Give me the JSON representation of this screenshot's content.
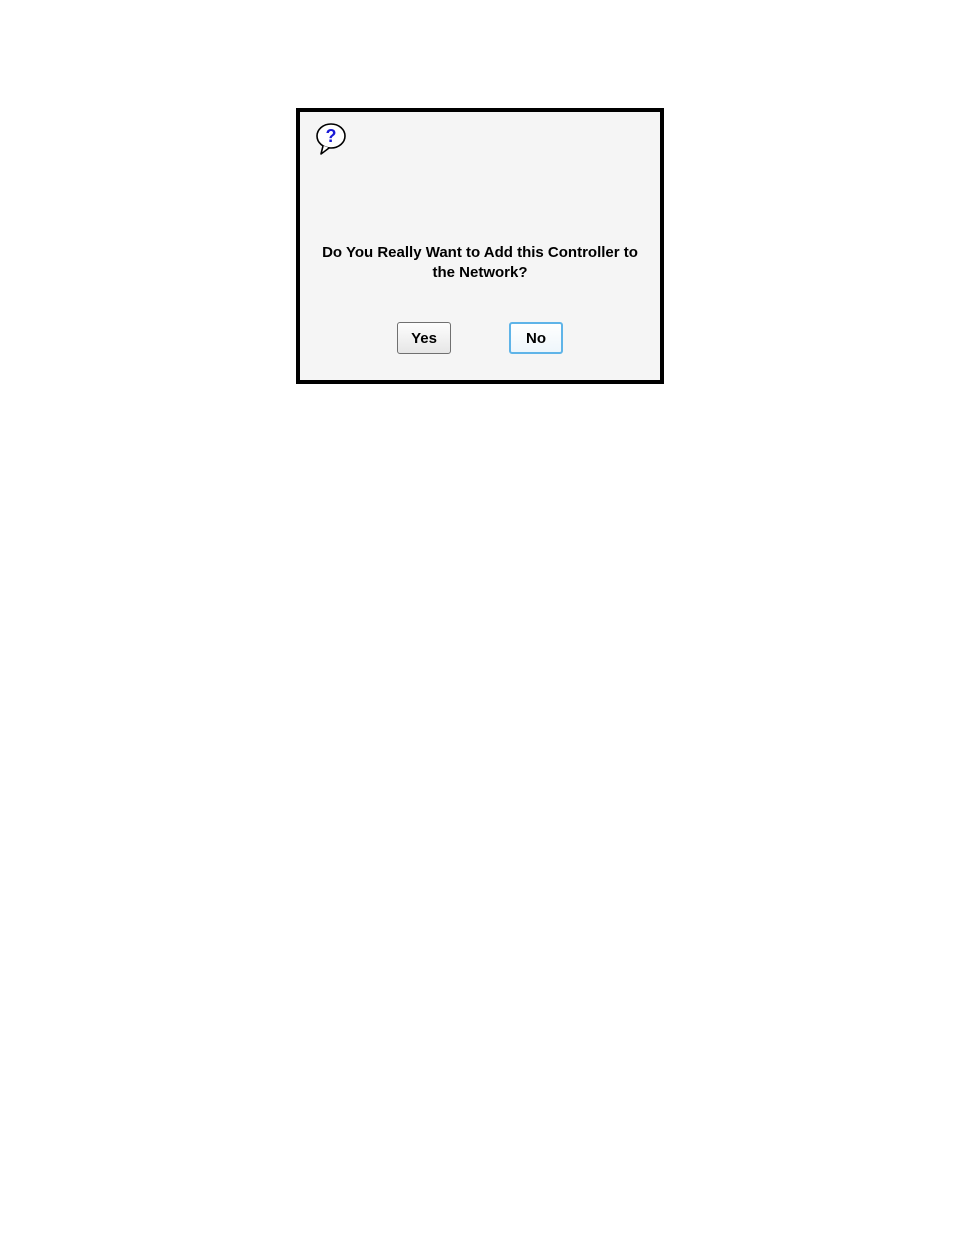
{
  "dialog": {
    "icon": "question-icon",
    "message": "Do You Really Want to Add this Controller to the Network?",
    "buttons": {
      "yes_label": "Yes",
      "no_label": "No"
    }
  }
}
